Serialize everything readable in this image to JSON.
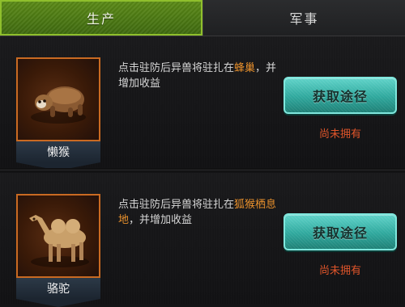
{
  "tabs": [
    {
      "label": "生产",
      "active": true
    },
    {
      "label": "军事",
      "active": false
    }
  ],
  "entries": [
    {
      "name": "懒猴",
      "desc_prefix": "点击驻防后异兽将驻扎在",
      "location": "蜂巢",
      "desc_suffix": "，并增加收益",
      "button_label": "获取途径",
      "status": "尚未拥有",
      "icon": "sloth-creature-icon"
    },
    {
      "name": "骆驼",
      "desc_prefix": "点击驻防后异兽将驻扎在",
      "location": "狐猴栖息地",
      "desc_suffix": "，并增加收益",
      "button_label": "获取途径",
      "status": "尚未拥有",
      "icon": "camel-creature-icon"
    }
  ],
  "colors": {
    "active_tab": "#4a7a12",
    "highlight": "#e8902c",
    "button": "#2fa89d",
    "status": "#e0552a"
  }
}
